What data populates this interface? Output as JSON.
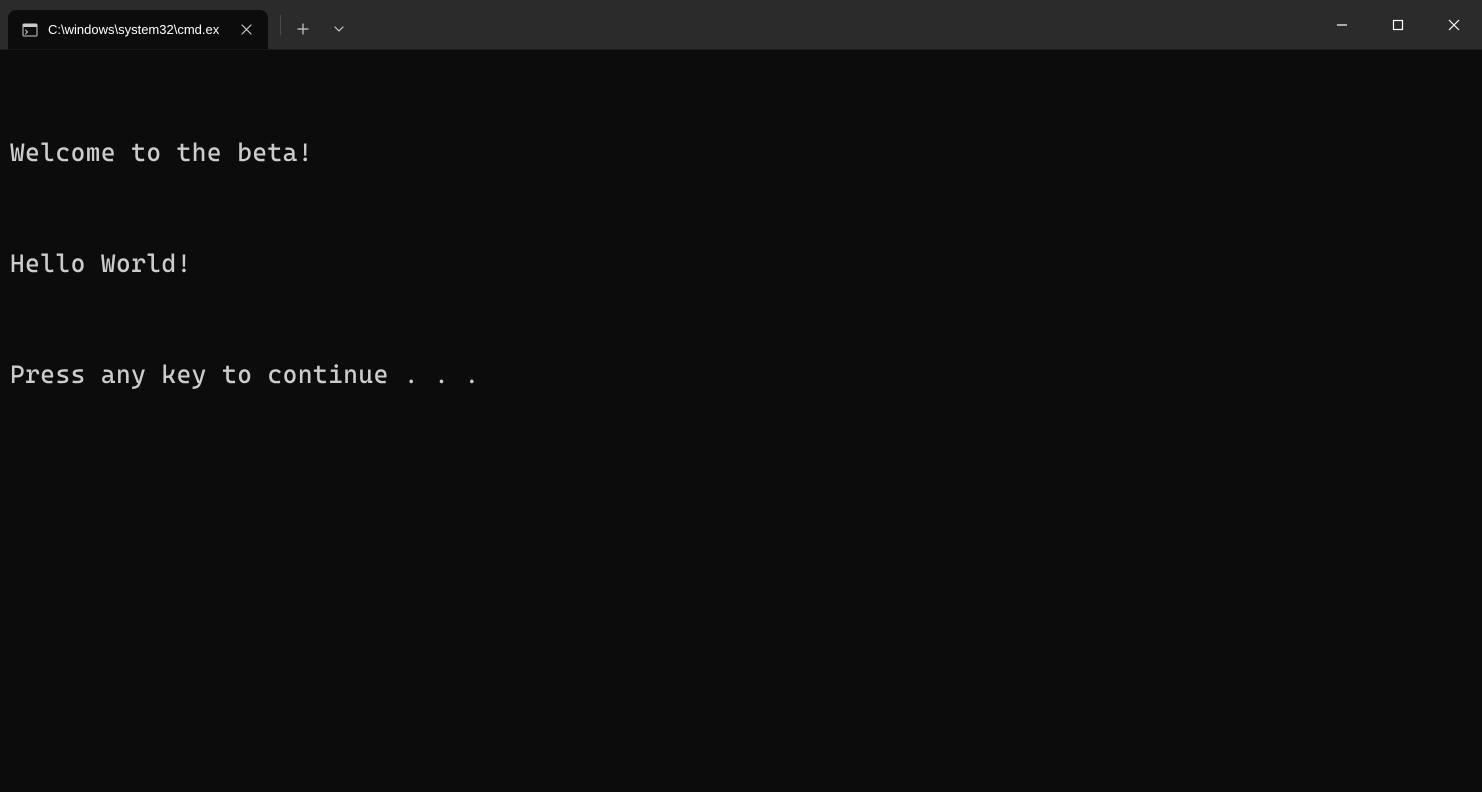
{
  "tab": {
    "title": "C:\\windows\\system32\\cmd.ex"
  },
  "terminal": {
    "lines": [
      "Welcome to the beta!",
      "Hello World!",
      "Press any key to continue . . ."
    ]
  }
}
